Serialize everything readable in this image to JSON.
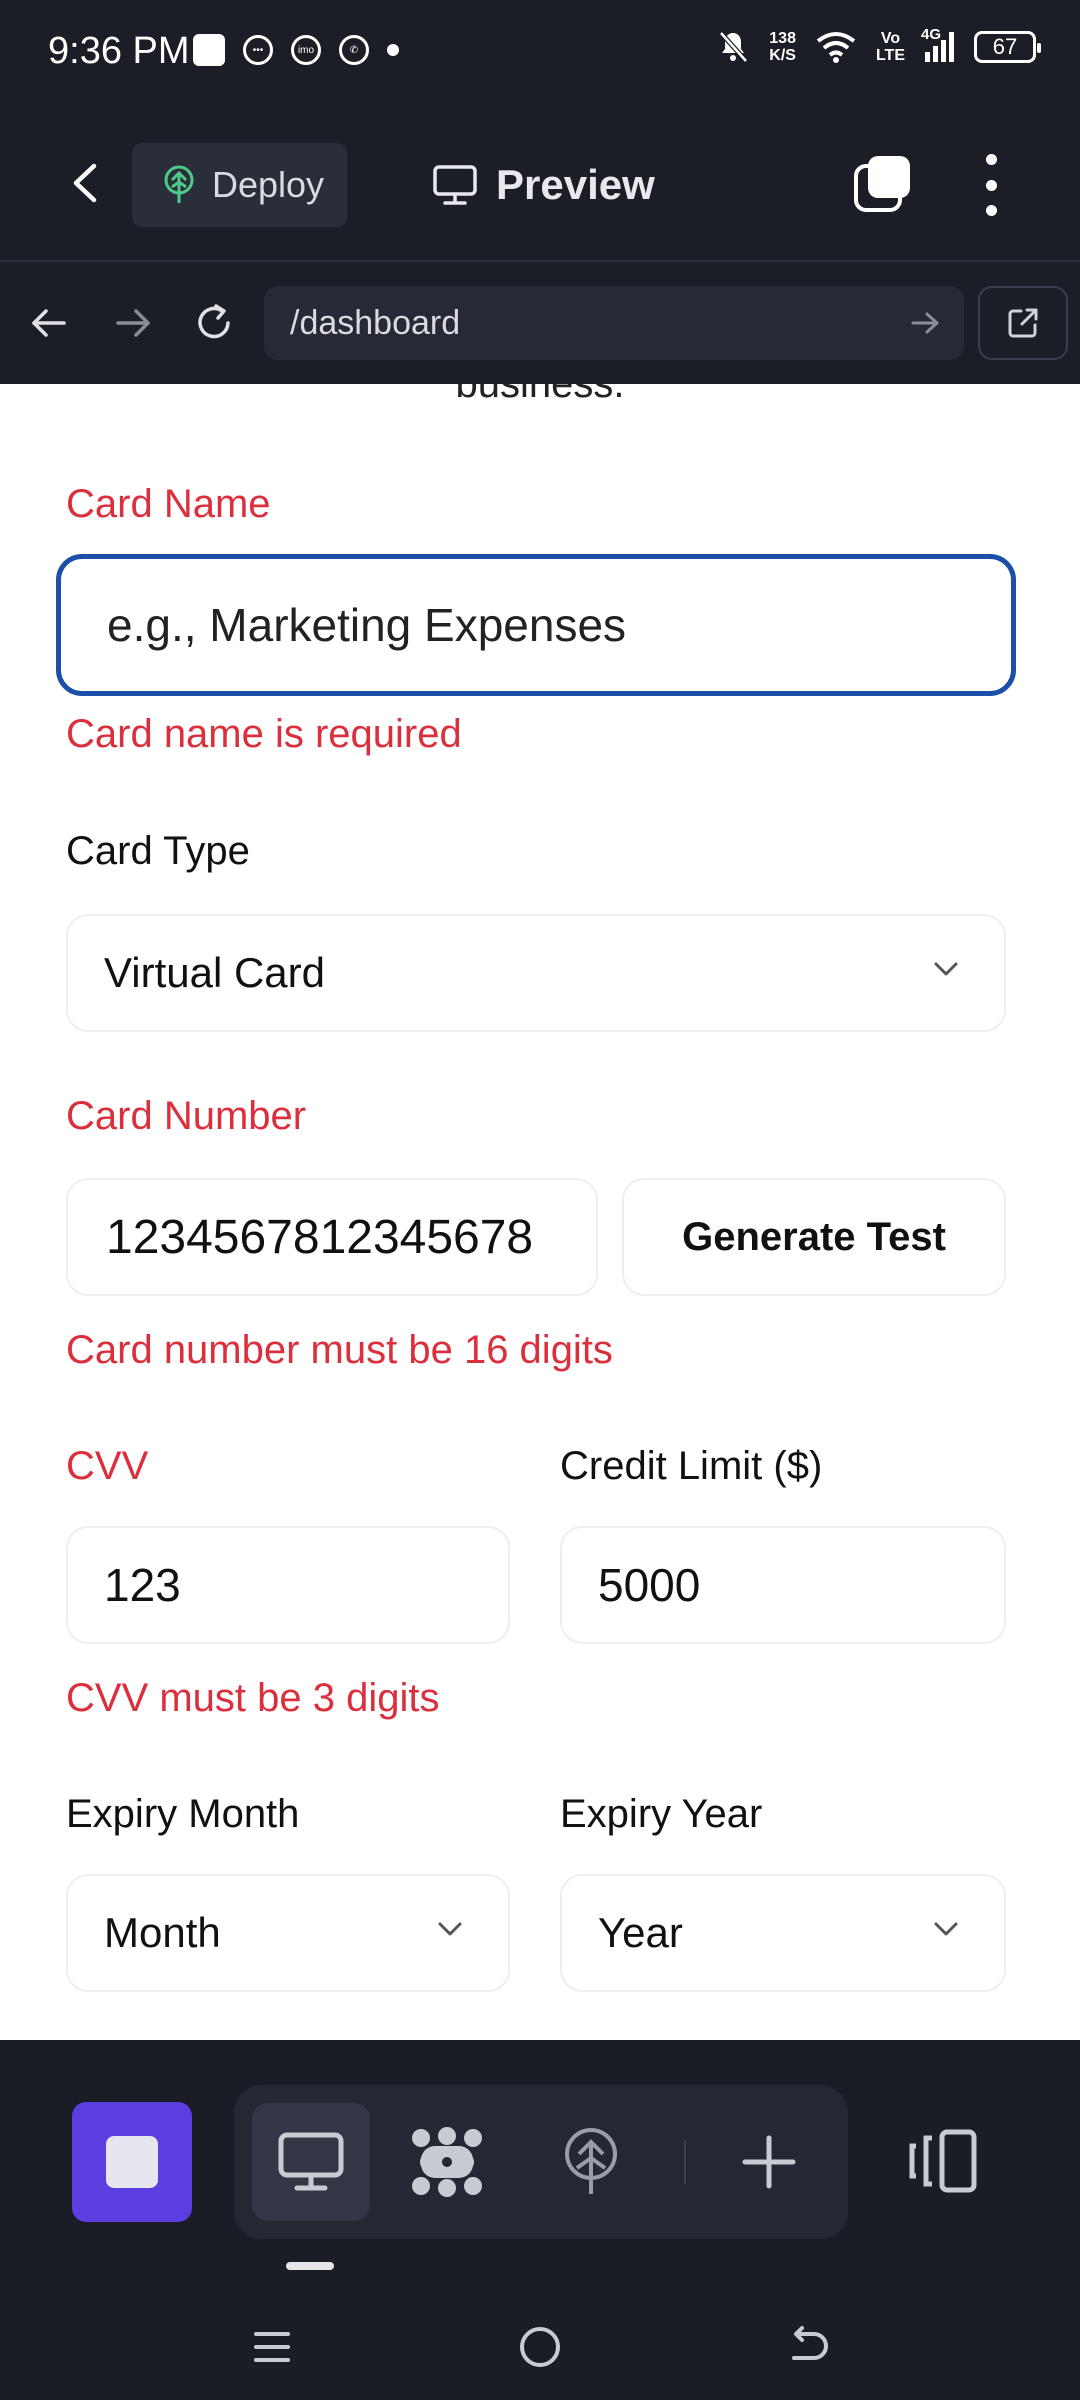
{
  "status_bar": {
    "time": "9:36 PM",
    "net_speed_top": "138",
    "net_speed_bottom": "K/S",
    "volte_top": "Vo",
    "volte_bottom": "LTE",
    "network": "4G",
    "battery": "67"
  },
  "app_bar": {
    "deploy_label": "Deploy",
    "preview_label": "Preview"
  },
  "url_bar": {
    "url": "/dashboard"
  },
  "form": {
    "cut_text": "business.",
    "card_name": {
      "label": "Card Name",
      "placeholder": "e.g., Marketing Expenses",
      "error": "Card name is required"
    },
    "card_type": {
      "label": "Card Type",
      "value": "Virtual Card"
    },
    "card_number": {
      "label": "Card Number",
      "value": "1234567812345678",
      "generate_label": "Generate Test",
      "error": "Card number must be 16 digits"
    },
    "cvv": {
      "label": "CVV",
      "value": "123",
      "error": "CVV must be 3 digits"
    },
    "credit_limit": {
      "label": "Credit Limit ($)",
      "value": "5000"
    },
    "expiry_month": {
      "label": "Expiry Month",
      "value": "Month"
    },
    "expiry_year": {
      "label": "Expiry Year",
      "value": "Year"
    }
  },
  "colors": {
    "error": "#dc2f3d",
    "focus_border": "#1b4fa8",
    "stop_button": "#5b3de0",
    "chrome_bg": "#1b1e27"
  },
  "icons": {
    "deploy": "tree-deploy-icon",
    "preview": "monitor-icon",
    "bottom_tools": [
      "monitor-icon",
      "cluster-icon",
      "deploy-icon",
      "plus-icon"
    ]
  }
}
